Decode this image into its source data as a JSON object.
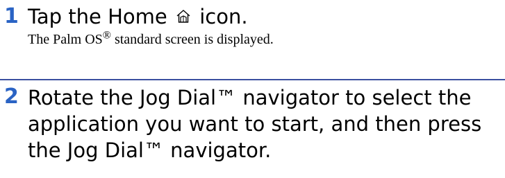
{
  "steps": [
    {
      "number": "1",
      "instruction_before": "Tap the Home",
      "icon": "home-icon",
      "instruction_after": "icon.",
      "result_before": "The Palm OS",
      "result_mark": "®",
      "result_after": " standard screen is displayed."
    },
    {
      "number": "2",
      "instruction": "Rotate the Jog Dial™ navigator to select the application you want to start, and then press the Jog Dial™ navigator."
    }
  ],
  "colors": {
    "step_number": "#2a63c4",
    "divider": "#3a4fa0"
  }
}
